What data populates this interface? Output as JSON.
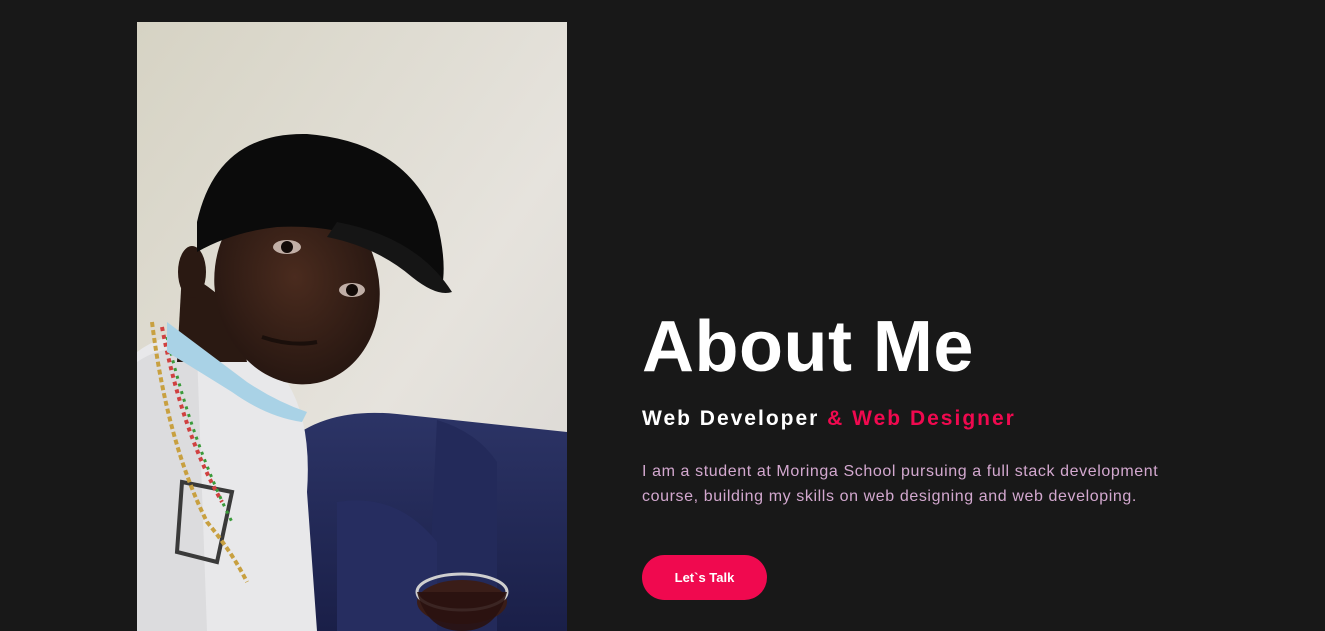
{
  "about": {
    "heading": "About Me",
    "subtitle_primary": "Web Developer ",
    "subtitle_accent": "& Web Designer",
    "description": "I am a student at Moringa School pursuing a full stack development course, building my skills on web designing and web developing.",
    "cta_label": "Let`s Talk"
  },
  "colors": {
    "background": "#181818",
    "accent": "#f0094f",
    "heading": "#ffffff",
    "description": "#d3a8cf"
  }
}
